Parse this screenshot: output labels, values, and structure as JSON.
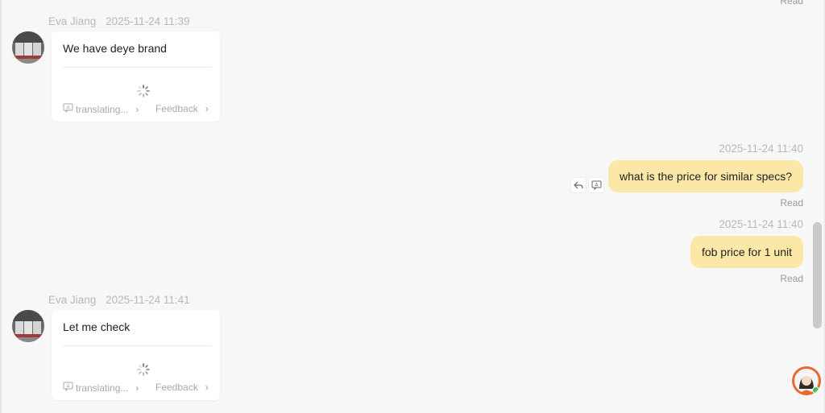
{
  "top": {
    "read_label": "Read"
  },
  "messages": [
    {
      "id": "m1",
      "direction": "incoming",
      "sender": "Eva Jiang",
      "time": "2025-11-24 11:39",
      "text": "We have deye brand",
      "translation_status": "translating...",
      "feedback_label": "Feedback"
    },
    {
      "id": "m2",
      "direction": "outgoing",
      "time": "2025-11-24 11:40",
      "text": "what is the price for similar specs?",
      "status": "Read"
    },
    {
      "id": "m3",
      "direction": "outgoing",
      "time": "2025-11-24 11:40",
      "text": "fob price for 1 unit",
      "status": "Read"
    },
    {
      "id": "m4",
      "direction": "incoming",
      "sender": "Eva Jiang",
      "time": "2025-11-24 11:41",
      "text": "Let me check",
      "translation_status": "translating...",
      "feedback_label": "Feedback"
    }
  ],
  "colors": {
    "background": "#f7f7f7",
    "outgoing_bubble": "#fce8a6",
    "incoming_card": "#ffffff",
    "meta_text": "#b8b8b8",
    "assistant_button": "#e9692c",
    "online_dot": "#3cc45c"
  },
  "icons": {
    "reply": "reply-arrow-icon",
    "translate": "translate-icon",
    "spinner": "loading-spinner-icon",
    "assistant": "assistant-avatar-icon"
  }
}
